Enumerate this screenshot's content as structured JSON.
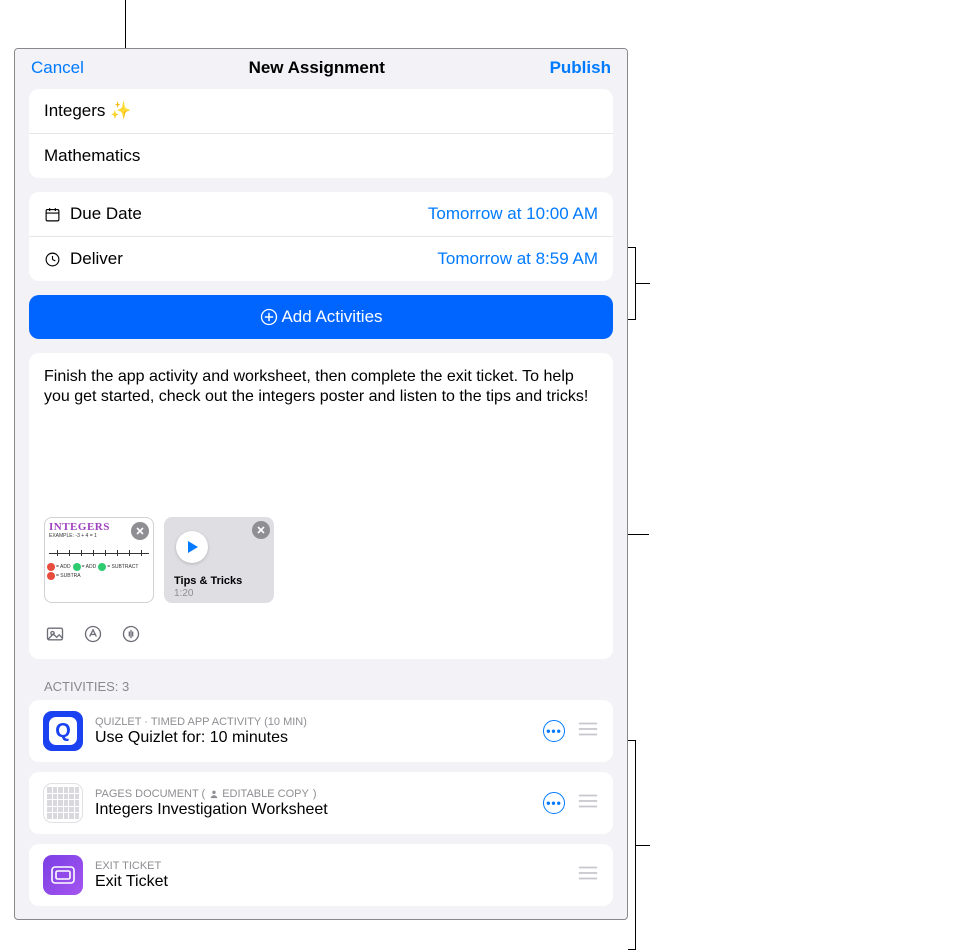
{
  "nav": {
    "cancel": "Cancel",
    "title": "New Assignment",
    "publish": "Publish"
  },
  "fields": {
    "title": "Integers ✨",
    "class": "Mathematics",
    "due_label": "Due Date",
    "due_value": "Tomorrow at 10:00 AM",
    "deliver_label": "Deliver",
    "deliver_value": "Tomorrow at 8:59 AM"
  },
  "add_activities": "Add Activities",
  "description": "Finish the app activity and worksheet, then complete the exit ticket. To help you get started, check out the integers poster and listen to the tips and tricks!",
  "attachments": {
    "poster_title": "INTEGERS",
    "audio_title": "Tips & Tricks",
    "audio_duration": "1:20"
  },
  "activities_header": "ACTIVITIES: 3",
  "activities": [
    {
      "meta": "QUIZLET · TIMED APP ACTIVITY (10 MIN)",
      "title": "Use Quizlet for: 10 minutes",
      "has_more": true,
      "icon": "quizlet"
    },
    {
      "meta_pre": "PAGES DOCUMENT  (",
      "meta_badge": "EDITABLE COPY",
      "meta_post": ")",
      "title": "Integers Investigation Worksheet",
      "has_more": true,
      "icon": "pages"
    },
    {
      "meta": "EXIT TICKET",
      "title": "Exit Ticket",
      "has_more": false,
      "icon": "exit"
    }
  ]
}
